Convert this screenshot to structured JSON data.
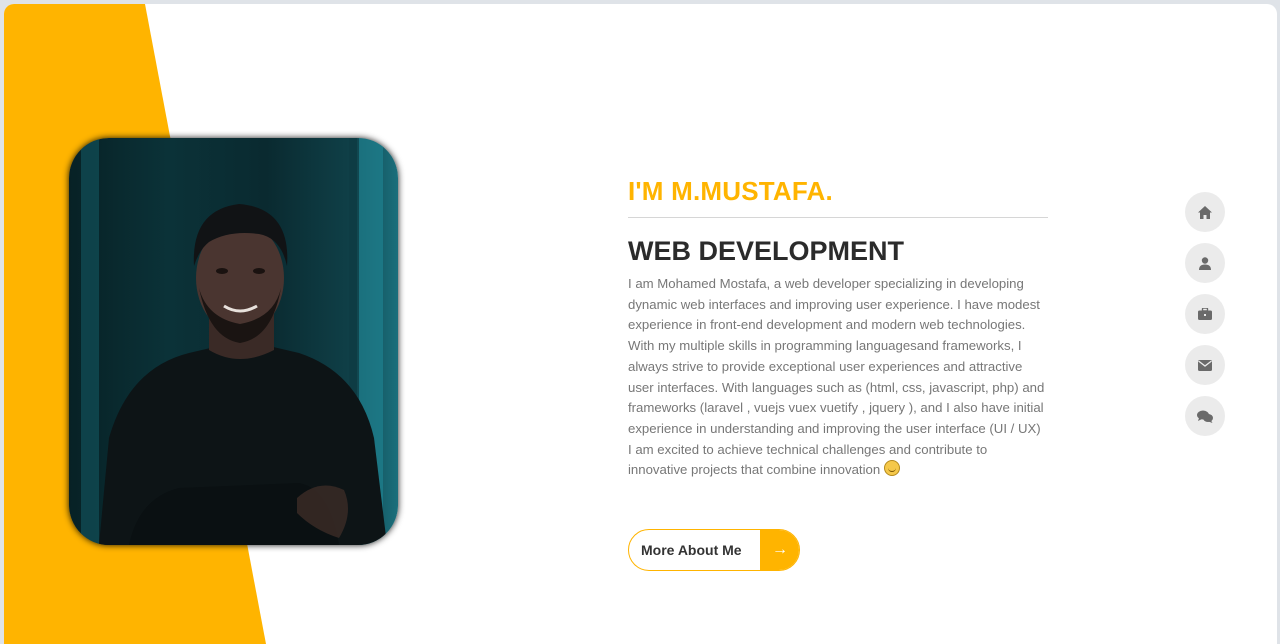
{
  "hero": {
    "name": "I'M M.MUSTAFA.",
    "role": "WEB DEVELOPMENT",
    "bio": "I am Mohamed Mostafa, a web developer specializing in developing dynamic web interfaces and improving user experience. I have modest experience in front-end development and modern web technologies. With my multiple skills in programming languagesand frameworks, I always strive to provide exceptional user experiences and attractive user interfaces. With languages such as (html, css, javascript, php) and frameworks (laravel , vuejs vuex vuetify , jquery ), and I also have initial experience in understanding and improving the user interface (UI / UX) I am excited to achieve technical challenges and contribute to innovative projects that combine innovation",
    "button_label": "More About Me",
    "button_icon": "arrow-right-icon"
  },
  "nav": {
    "items": [
      {
        "icon": "home-icon"
      },
      {
        "icon": "user-icon"
      },
      {
        "icon": "briefcase-icon"
      },
      {
        "icon": "envelope-icon"
      },
      {
        "icon": "comments-icon"
      }
    ]
  },
  "colors": {
    "accent": "#ffb400",
    "nav_bg": "#ebebeb",
    "nav_icon": "#6a6a6a"
  }
}
